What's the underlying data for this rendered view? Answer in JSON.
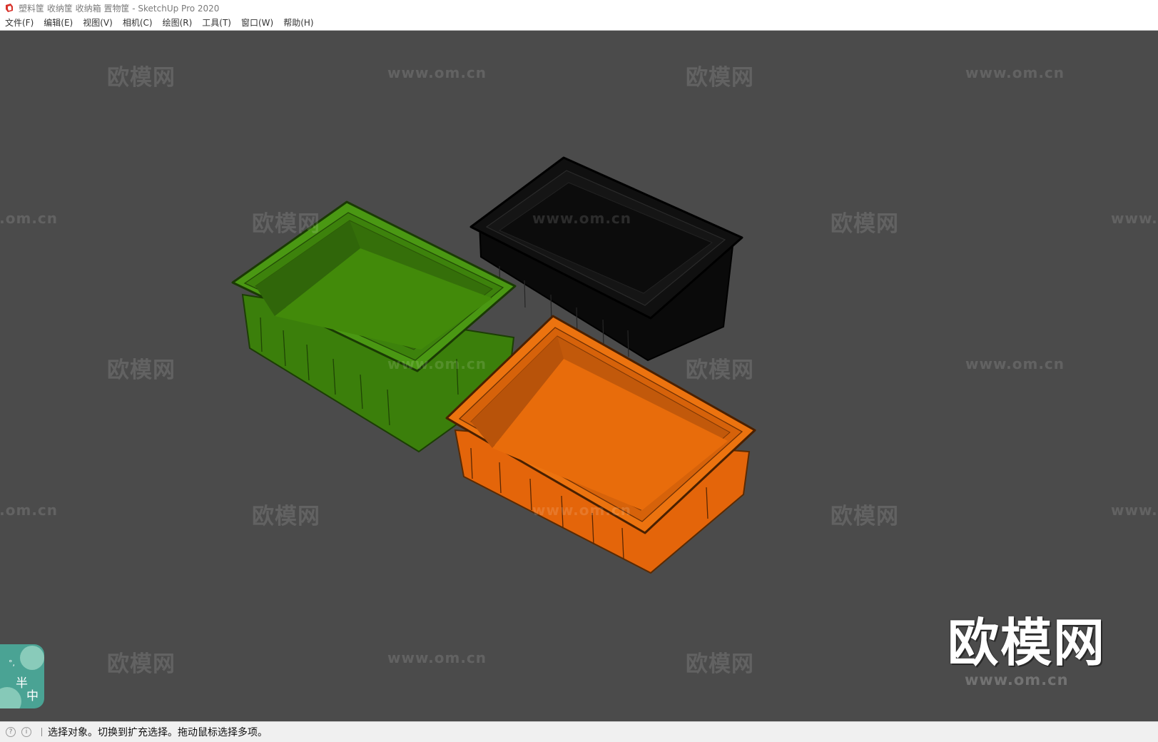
{
  "window": {
    "title": "塑料筐 收纳筐 收纳箱 置物筐 - SketchUp Pro 2020"
  },
  "menubar": {
    "items": [
      {
        "label": "文件(F)"
      },
      {
        "label": "编辑(E)"
      },
      {
        "label": "视图(V)"
      },
      {
        "label": "相机(C)"
      },
      {
        "label": "绘图(R)"
      },
      {
        "label": "工具(T)"
      },
      {
        "label": "窗口(W)"
      },
      {
        "label": "帮助(H)"
      }
    ]
  },
  "viewport": {
    "background": "#4b4b4b",
    "models": [
      {
        "name": "green-crate",
        "color": "#3f8a0c"
      },
      {
        "name": "black-crate",
        "color": "#0d0d0d"
      },
      {
        "name": "orange-crate",
        "color": "#e86c0b"
      }
    ],
    "watermark": {
      "cn": "欧模网",
      "url": "www.om.cn"
    },
    "ime": {
      "half": "半",
      "mode": "中"
    }
  },
  "statusbar": {
    "text": "选择对象。切换到扩充选择。拖动鼠标选择多项。",
    "icons": [
      "geo-location-icon",
      "info-icon"
    ]
  }
}
